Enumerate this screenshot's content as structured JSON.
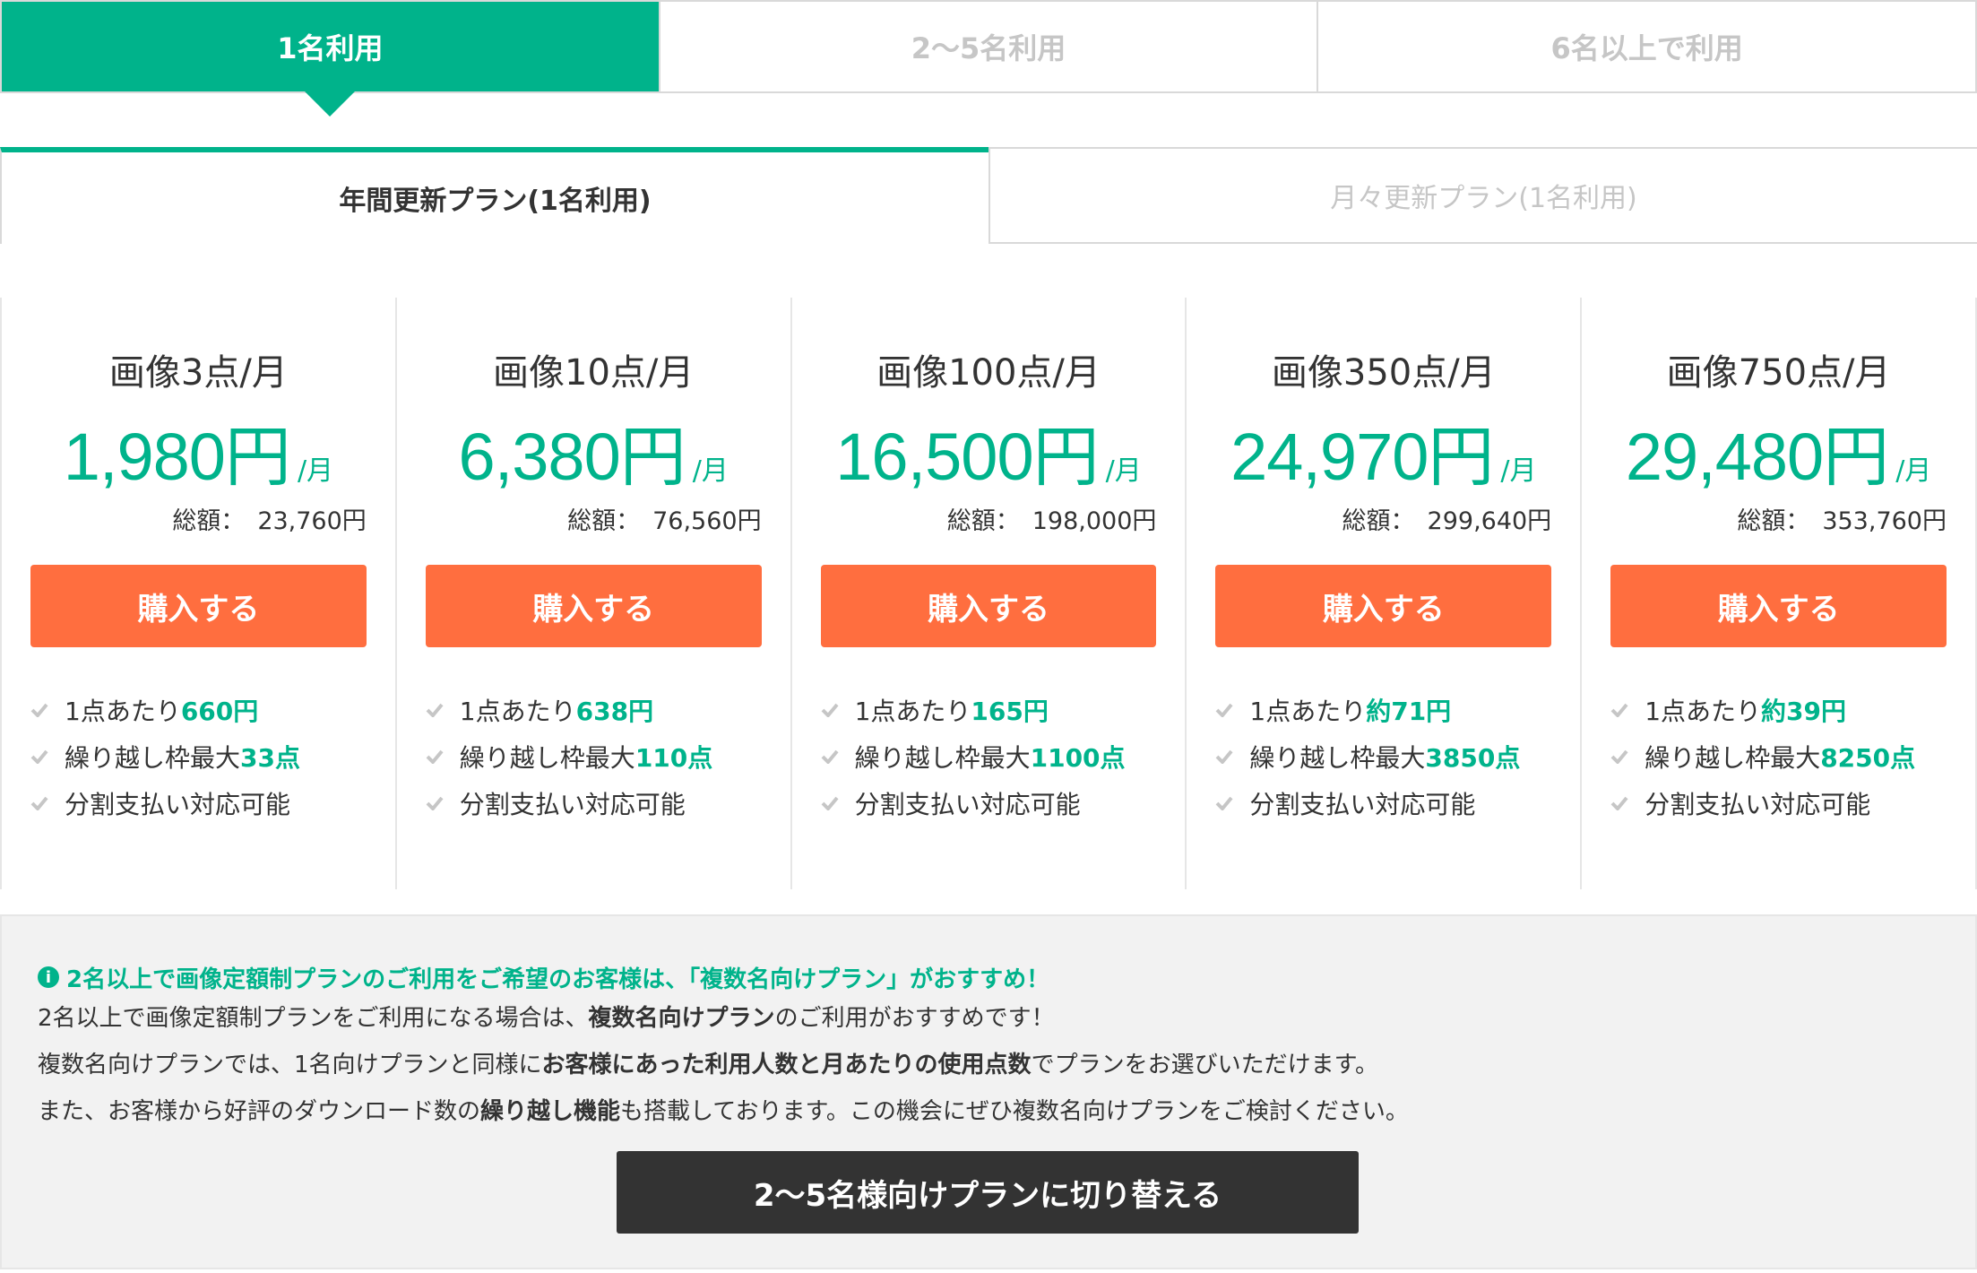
{
  "user_tabs": [
    {
      "label": "1名利用",
      "active": true
    },
    {
      "label": "2〜5名利用",
      "active": false
    },
    {
      "label": "6名以上で利用",
      "active": false
    }
  ],
  "plan_tabs": [
    {
      "label": "年間更新プラン(1名利用)",
      "active": true
    },
    {
      "label": "月々更新プラン(1名利用)",
      "active": false
    }
  ],
  "plans": [
    {
      "title": "画像3点/月",
      "price": "1,980円",
      "per": "/月",
      "total_label": "総額：",
      "total": "23,760円",
      "buy_label": "購入する",
      "features": [
        {
          "text": "1点あたり",
          "highlight": "660円"
        },
        {
          "text": "繰り越し枠最大",
          "highlight": "33点"
        },
        {
          "text": "分割支払い対応可能",
          "highlight": ""
        }
      ]
    },
    {
      "title": "画像10点/月",
      "price": "6,380円",
      "per": "/月",
      "total_label": "総額：",
      "total": "76,560円",
      "buy_label": "購入する",
      "features": [
        {
          "text": "1点あたり",
          "highlight": "638円"
        },
        {
          "text": "繰り越し枠最大",
          "highlight": "110点"
        },
        {
          "text": "分割支払い対応可能",
          "highlight": ""
        }
      ]
    },
    {
      "title": "画像100点/月",
      "price": "16,500円",
      "per": "/月",
      "total_label": "総額：",
      "total": "198,000円",
      "buy_label": "購入する",
      "features": [
        {
          "text": "1点あたり",
          "highlight": "165円"
        },
        {
          "text": "繰り越し枠最大",
          "highlight": "1100点"
        },
        {
          "text": "分割支払い対応可能",
          "highlight": ""
        }
      ]
    },
    {
      "title": "画像350点/月",
      "price": "24,970円",
      "per": "/月",
      "total_label": "総額：",
      "total": "299,640円",
      "buy_label": "購入する",
      "features": [
        {
          "text": "1点あたり",
          "highlight": "約71円"
        },
        {
          "text": "繰り越し枠最大",
          "highlight": "3850点"
        },
        {
          "text": "分割支払い対応可能",
          "highlight": ""
        }
      ]
    },
    {
      "title": "画像750点/月",
      "price": "29,480円",
      "per": "/月",
      "total_label": "総額：",
      "total": "353,760円",
      "buy_label": "購入する",
      "features": [
        {
          "text": "1点あたり",
          "highlight": "約39円"
        },
        {
          "text": "繰り越し枠最大",
          "highlight": "8250点"
        },
        {
          "text": "分割支払い対応可能",
          "highlight": ""
        }
      ]
    }
  ],
  "info": {
    "icon": "info-icon",
    "heading": "2名以上で画像定額制プランのご利用をご希望のお客様は、「複数名向けプラン」がおすすめ！",
    "line1": {
      "a": "2名以上で画像定額制プランをご利用になる場合は、",
      "b": "複数名向けプラン",
      "c": "のご利用がおすすめです！"
    },
    "line2": {
      "a": "複数名向けプランでは、1名向けプランと同様に",
      "b": "お客様にあった利用人数と月あたりの使用点数",
      "c": "でプランをお選びいただけます。"
    },
    "line3": {
      "a": "また、お客様から好評のダウンロード数の",
      "b": "繰り越し機能",
      "c": "も搭載しております。この機会にぜひ複数名向けプランをご検討ください。"
    },
    "button_label": "2〜5名様向けプランに切り替える"
  },
  "colors": {
    "accent": "#00b38b",
    "buy_button": "#ff6e3f",
    "switch_button": "#333333",
    "info_bg": "#f2f2f2"
  }
}
